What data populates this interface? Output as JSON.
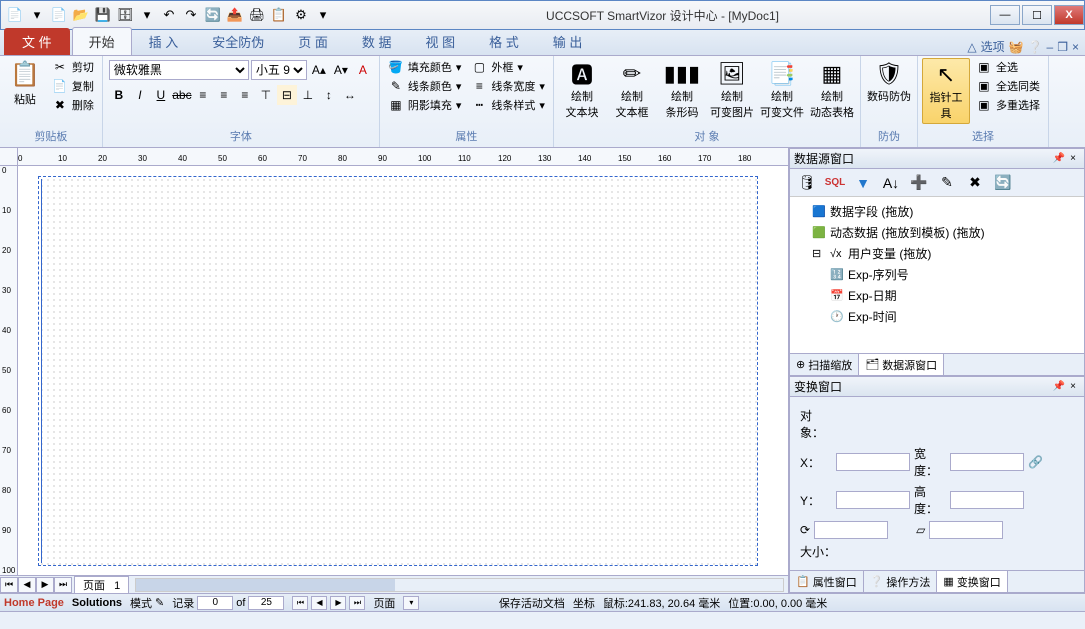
{
  "title": "UCCSOFT SmartVizor 设计中心 - [MyDoc1]",
  "win": {
    "min": "—",
    "max": "☐",
    "close": "X"
  },
  "tabs": {
    "file": "文 件",
    "items": [
      "开始",
      "插 入",
      "安全防伪",
      "页 面",
      "数 据",
      "视 图",
      "格 式",
      "输 出"
    ],
    "options": "选项",
    "mdi_min": "–",
    "mdi_restore": "❐",
    "mdi_close": "×"
  },
  "ribbon": {
    "clipboard": {
      "label": "剪贴板",
      "paste": "粘贴",
      "cut": "剪切",
      "copy": "复制",
      "delete": "删除"
    },
    "font": {
      "label": "字体",
      "family": "微软雅黑",
      "size": "小五 9"
    },
    "attr": {
      "label": "属性",
      "fill": "填充颜色",
      "lcolor": "线条颜色",
      "shadow": "阴影填充",
      "border": "外框",
      "lwidth": "线条宽度",
      "lstyle": "线条样式"
    },
    "obj": {
      "label": "对 象",
      "textblock": "绘制\n文本块",
      "textbox": "绘制\n文本框",
      "barcode": "绘制\n条形码",
      "varimg": "绘制\n可变图片",
      "varfile": "绘制\n可变文件",
      "dyntable": "绘制\n动态表格"
    },
    "sec": {
      "label": "防伪",
      "secnum": "数码防伪"
    },
    "sel": {
      "label": "选择",
      "pointer": "指针工具",
      "all": "全选",
      "same": "全选同类",
      "multi": "多重选择"
    }
  },
  "ruler_h": [
    "0",
    "10",
    "20",
    "30",
    "40",
    "50",
    "60",
    "70",
    "80",
    "90",
    "100",
    "110",
    "120",
    "130",
    "140",
    "150",
    "160",
    "170",
    "180"
  ],
  "ruler_v": [
    "0",
    "10",
    "20",
    "30",
    "40",
    "50",
    "60",
    "70",
    "80",
    "90",
    "100"
  ],
  "page_nav": {
    "label": "页面",
    "num": "1"
  },
  "ds_panel": {
    "title": "数据源窗口",
    "items": {
      "fields": "数据字段 (拖放)",
      "dyn": "动态数据 (拖放到模板) (拖放)",
      "uservar": "用户变量 (拖放)",
      "seq": "Exp-序列号",
      "date": "Exp-日期",
      "time": "Exp-时间"
    },
    "tabs": {
      "zoom": "扫描缩放",
      "ds": "数据源窗口"
    }
  },
  "tr_panel": {
    "title": "变换窗口",
    "object": "对象：",
    "x": "X：",
    "y": "Y：",
    "w": "宽度：",
    "h": "高度：",
    "size": "大小：",
    "tabs": {
      "prop": "属性窗口",
      "help": "操作方法",
      "tr": "变换窗口"
    }
  },
  "status": {
    "home": "Home Page",
    "sol": "Solutions",
    "mode": "模式",
    "rec": "记录",
    "cur": "0",
    "of": "of",
    "total": "25",
    "page": "页面",
    "save": "保存活动文档",
    "coord": "坐标",
    "mouse": "鼠标:241.83, 20.64 毫米",
    "pos": "位置:0.00, 0.00 毫米"
  }
}
